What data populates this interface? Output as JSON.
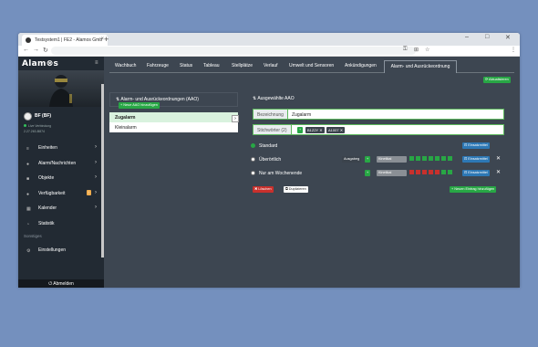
{
  "browser": {
    "tab_title": "Testsystem1 | FE2 - Alamos Gmb",
    "close": "×",
    "new_tab": "+",
    "minimize": "–",
    "maximize": "□",
    "close_window": "✕",
    "back": "←",
    "forward": "→",
    "reload": "↻",
    "key": "⚿",
    "install": "⊞",
    "star": "☆",
    "menu": "⋮"
  },
  "app": {
    "logo": "Alam⊗s",
    "burger": "≡",
    "profile_name": "BF (BF)",
    "status": "Live Verbindung",
    "number": "2.27.263-B874",
    "logout": "Abmelden",
    "menu": [
      {
        "label": "Einheiten",
        "icon": "≡",
        "chevron": "›"
      },
      {
        "label": "Alarm/Nachrichten",
        "icon": "●",
        "chevron": "›"
      },
      {
        "label": "Objekte",
        "icon": "■",
        "chevron": "›"
      },
      {
        "label": "Verfügbarkeit",
        "icon": "●",
        "chevron": "›",
        "badge": "!"
      },
      {
        "label": "Kalender",
        "icon": "▦",
        "chevron": "›"
      },
      {
        "label": "Statistik",
        "icon": "◔",
        "chevron": ""
      }
    ],
    "section": "Sonstiges",
    "settings": "Einstellungen",
    "settings_icon": "⚙"
  },
  "tabs": [
    "Wachbuch",
    "Fahrzeuge",
    "Status",
    "Tableau",
    "Stellplätze",
    "Verlauf",
    "Umwelt und Sensoren",
    "Ankündigungen",
    "Alarm- und Ausrückeordnung"
  ],
  "main": {
    "update_btn": "Aktualisieren",
    "left_title": "Alarm- und Ausrückeordnungen (AAO)",
    "new_btn": "+ Neue AAO hinzufügen",
    "items": [
      "Zugalarm",
      "Kleinalarm"
    ],
    "right_title": "Ausgewählte AAO",
    "bez_label": "Bezeichnung",
    "bez_value": "Zugalarm",
    "stich_label": "Stichwörter (2)",
    "chips": [
      "B1Z2Y",
      "A1007"
    ],
    "rows": [
      {
        "label": "Standard",
        "on": true,
        "action": "Einsatzmittel"
      },
      {
        "label": "Überörtlich",
        "on": false,
        "badge": "Ausgabeg",
        "filter": "Kinetikal",
        "action": "Einsatzmittel"
      },
      {
        "label": "Nur am Wochenende",
        "on": false,
        "filter": "Kinetikal",
        "action": "Einsatzmittel"
      }
    ],
    "delete_btn": "Löschen",
    "dup_btn": "Duplizieren",
    "new_entry_btn": "+ Neuen Eintrag hinzufügen"
  },
  "colors": {
    "accent": "#28a745",
    "sidebar": "#222a33",
    "content": "#3d4651"
  }
}
